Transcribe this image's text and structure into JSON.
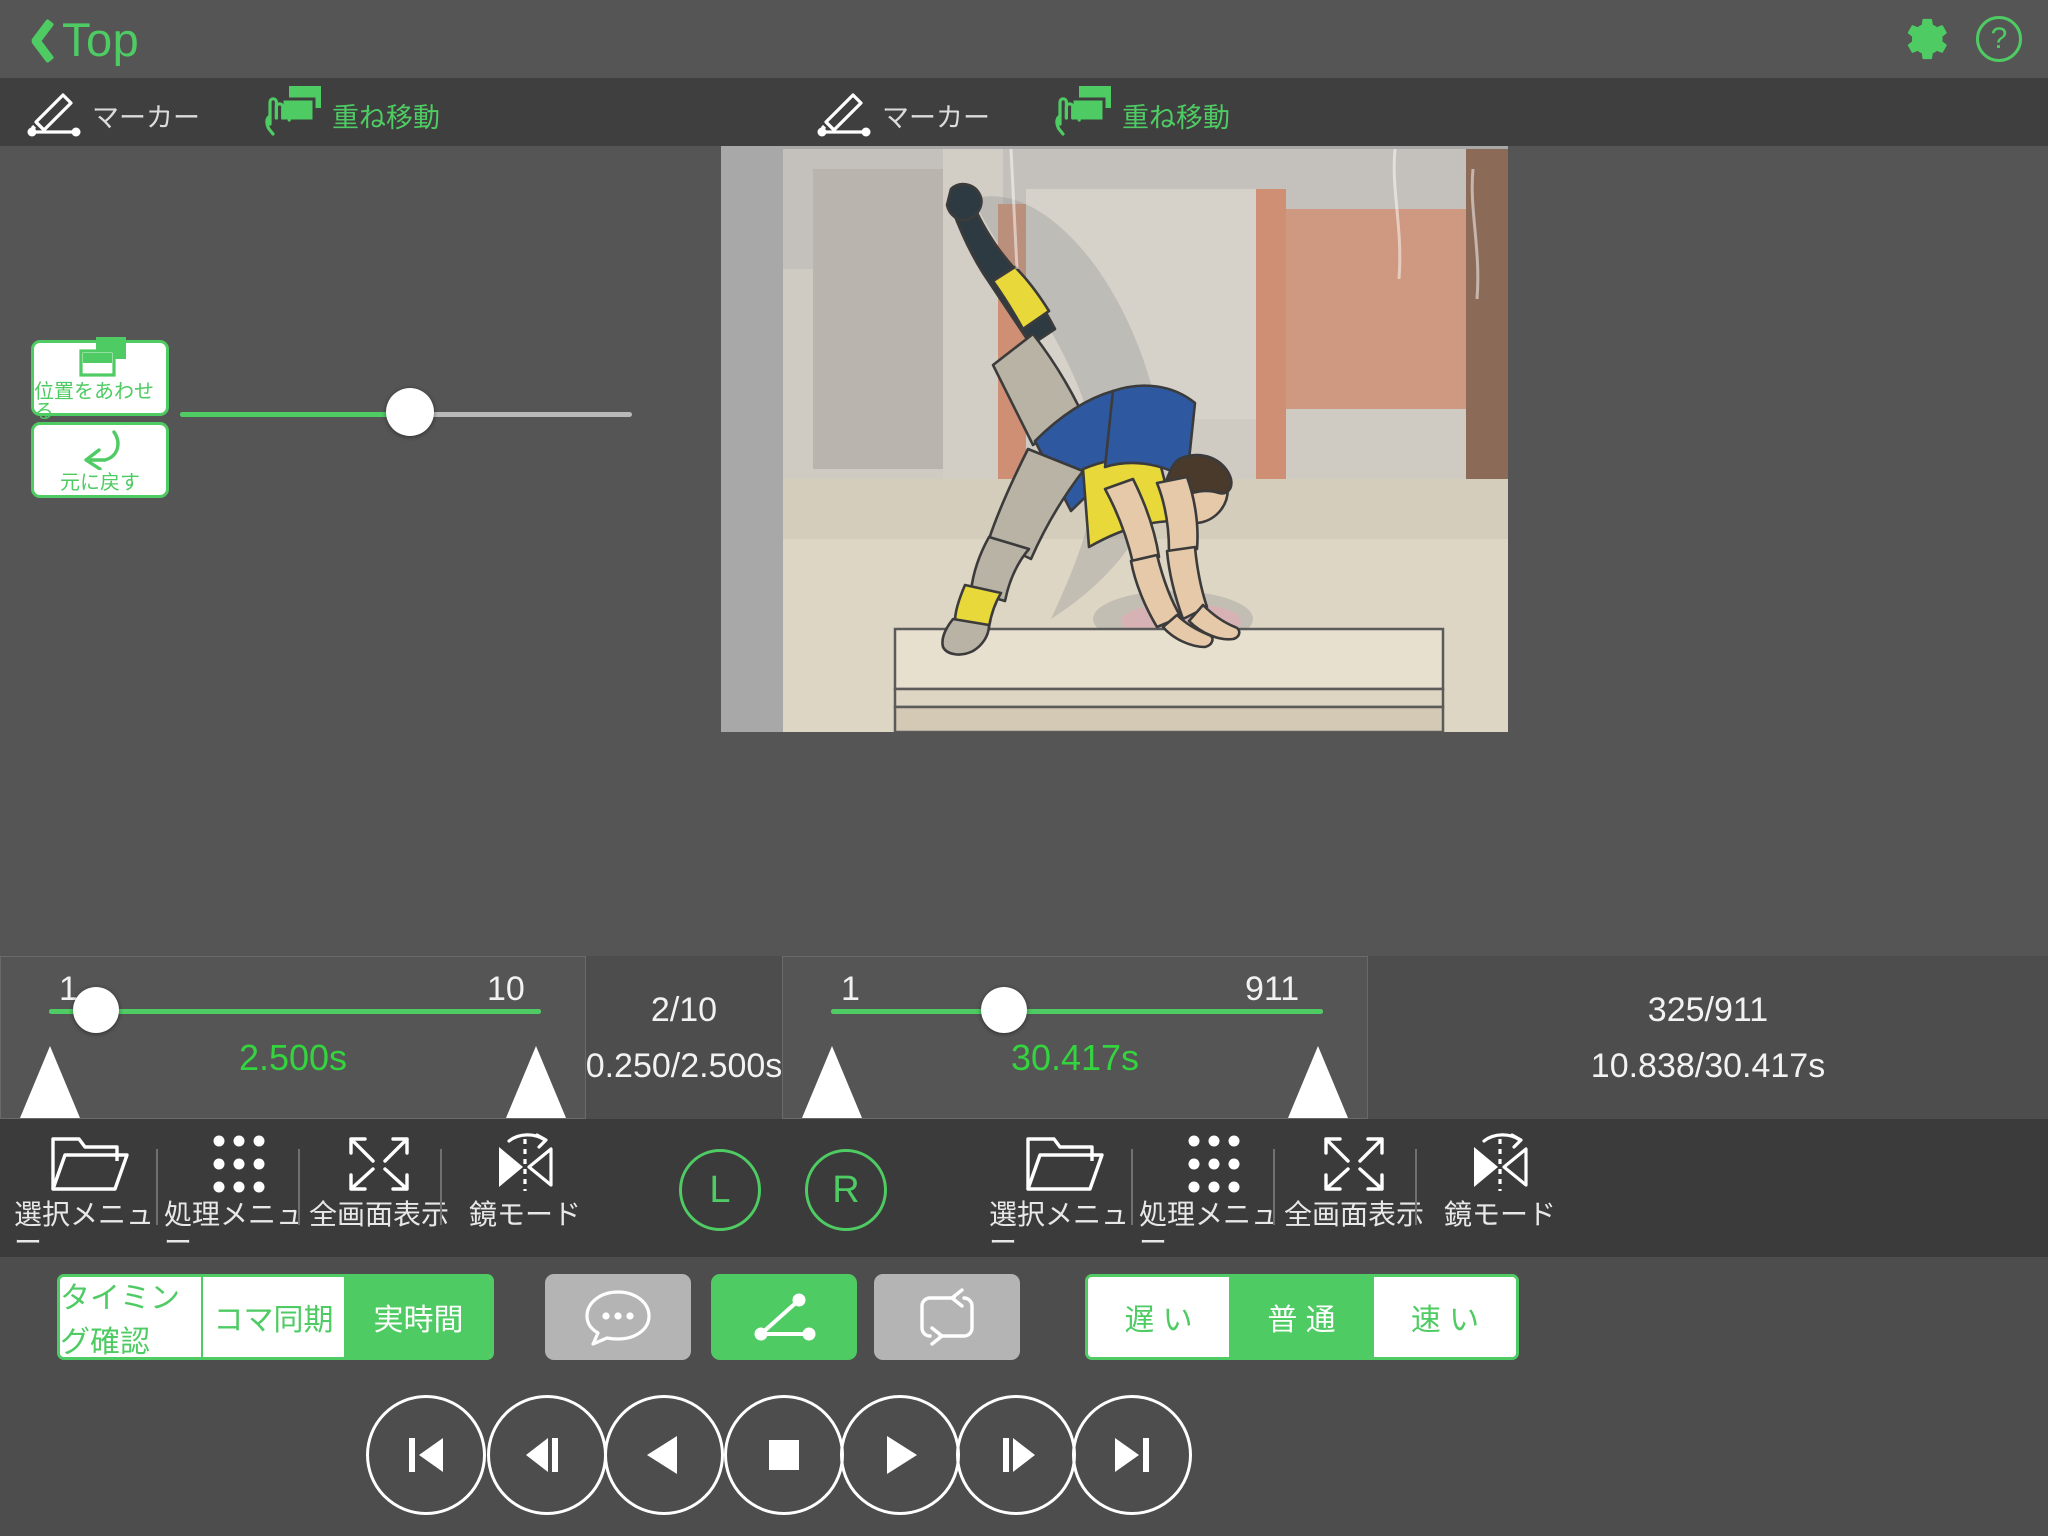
{
  "header": {
    "back_label": "Top",
    "back_icon": "chevron-left-icon",
    "gear_icon": "gear-icon",
    "help_label": "?"
  },
  "toolstrip": {
    "left": {
      "marker_label": "マーカー",
      "marker_icon": "pen-marker-icon",
      "overlay_move_label": "重ね移動",
      "overlay_move_icon": "hand-drag-layers-icon"
    },
    "right": {
      "marker_label": "マーカー",
      "marker_icon": "pen-marker-icon",
      "overlay_move_label": "重ね移動",
      "overlay_move_icon": "hand-drag-layers-icon"
    }
  },
  "left_pane": {
    "align_button": {
      "label": "位置をあわせる",
      "icon": "layers-align-icon"
    },
    "undo_button": {
      "label": "元に戻す",
      "icon": "undo-arrow-icon"
    },
    "opacity_slider": {
      "min": 0,
      "max": 100,
      "value": 50
    }
  },
  "timeline_left": {
    "min_label": "1",
    "max_label": "10",
    "duration_label": "2.500s",
    "value": 2,
    "readout_frames": "2/10",
    "readout_time": "0.250/2.500s"
  },
  "timeline_right": {
    "min_label": "1",
    "max_label": "911",
    "duration_label": "30.417s",
    "value": 325,
    "readout_frames": "325/911",
    "readout_time": "10.838/30.417s"
  },
  "icon_toolbar_left": [
    {
      "label": "選択メニュー",
      "icon": "folder-open-icon"
    },
    {
      "label": "処理メニュー",
      "icon": "grid-dots-icon"
    },
    {
      "label": "全画面表示",
      "icon": "expand-arrows-icon"
    },
    {
      "label": "鏡モード",
      "icon": "mirror-mode-icon"
    }
  ],
  "icon_toolbar_right": [
    {
      "label": "選択メニュー",
      "icon": "folder-open-icon"
    },
    {
      "label": "処理メニュー",
      "icon": "grid-dots-icon"
    },
    {
      "label": "全画面表示",
      "icon": "expand-arrows-icon"
    },
    {
      "label": "鏡モード",
      "icon": "mirror-mode-icon"
    }
  ],
  "channel_buttons": {
    "left": "L",
    "right": "R"
  },
  "sync_mode": {
    "options": [
      "タイミング確認",
      "コマ同期",
      "実時間"
    ],
    "selected": "実時間"
  },
  "tool_buttons": [
    {
      "icon": "comment-bubble-icon",
      "state": "off"
    },
    {
      "icon": "angle-measure-icon",
      "state": "on"
    },
    {
      "icon": "loop-repeat-icon",
      "state": "off"
    }
  ],
  "speed_mode": {
    "options": [
      "遅 い",
      "普 通",
      "速 い"
    ],
    "selected": "普 通"
  },
  "transport": [
    {
      "icon": "skip-to-start-icon"
    },
    {
      "icon": "step-back-icon"
    },
    {
      "icon": "play-reverse-icon"
    },
    {
      "icon": "stop-icon"
    },
    {
      "icon": "play-icon"
    },
    {
      "icon": "step-forward-icon"
    },
    {
      "icon": "skip-to-end-icon"
    }
  ],
  "colors": {
    "accent_green": "#4ecb62",
    "bright_green": "#34d43f",
    "header_bg": "#555555",
    "panel_bg": "#4d4d4d",
    "toolbar_bg": "#3b3b3b",
    "gray_button": "#b4b4b4"
  }
}
